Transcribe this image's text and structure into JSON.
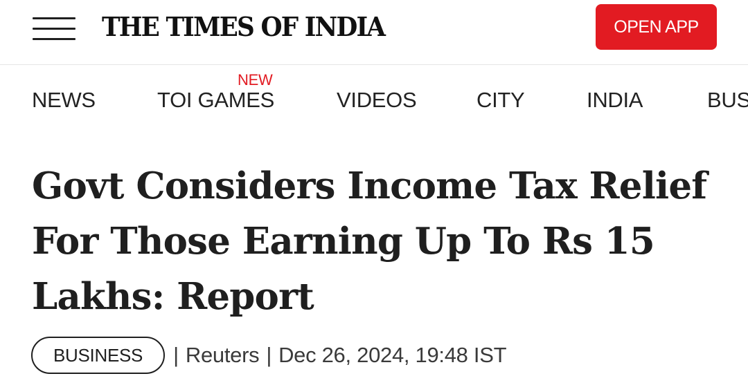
{
  "header": {
    "menu_icon": "hamburger-menu-icon",
    "logo_text": "THE TIMES OF INDIA",
    "open_app_label": "OPEN APP",
    "accent_color": "#e21b22"
  },
  "nav": {
    "items": [
      {
        "label": "NEWS"
      },
      {
        "label": "TOI GAMES",
        "badge": "NEW"
      },
      {
        "label": "VIDEOS"
      },
      {
        "label": "CITY"
      },
      {
        "label": "INDIA"
      },
      {
        "label": "BUS"
      }
    ]
  },
  "article": {
    "headline": "Govt Considers Income Tax Relief For Those Earning Up To Rs 15 Lakhs: Report",
    "category": "BUSINESS",
    "source": "Reuters",
    "timestamp": "Dec 26, 2024, 19:48 IST",
    "separator": "|"
  }
}
